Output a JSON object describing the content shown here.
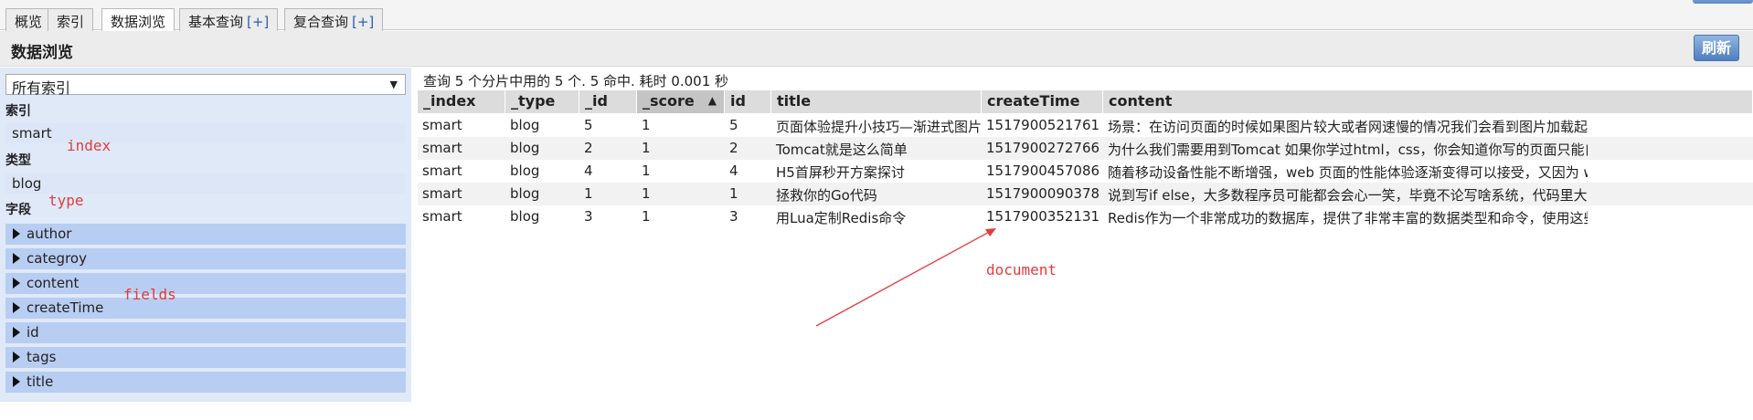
{
  "tabs": [
    {
      "label": "概览",
      "plus": ""
    },
    {
      "label": "索引",
      "plus": ""
    },
    {
      "label": "数据浏览",
      "plus": ""
    },
    {
      "label": "基本查询",
      "plus": "[+]"
    },
    {
      "label": "复合查询",
      "plus": "[+]"
    }
  ],
  "header": {
    "title": "数据浏览",
    "refresh_label": "刷新"
  },
  "sidebar": {
    "index_select": "所有索引",
    "index_label": "索引",
    "index_value": "smart",
    "type_label": "类型",
    "type_value": "blog",
    "fields_label": "字段",
    "fields": [
      "author",
      "categroy",
      "content",
      "createTime",
      "id",
      "tags",
      "title"
    ]
  },
  "annotations": {
    "index": "index",
    "type": "type",
    "fields": "fields",
    "document": "document"
  },
  "results": {
    "summary": "查询 5 个分片中用的 5 个. 5 命中. 耗时 0.001 秒",
    "columns": [
      "_index",
      "_type",
      "_id",
      "_score",
      "id",
      "title",
      "createTime",
      "content"
    ],
    "sort_arrow": "▲",
    "rows": [
      [
        "smart",
        "blog",
        "5",
        "1",
        "5",
        "页面体验提升小技巧—渐进式图片",
        "1517900521761",
        "场景：在访问页面的时候如果图片较大或者网速慢的情况我们会看到图片加载起来是有一个明显过程的，就是"
      ],
      [
        "smart",
        "blog",
        "2",
        "1",
        "2",
        "Tomcat就是这么简单",
        "1517900272766",
        "为什么我们需要用到Tomcat 如果你学过html，css，你会知道你写的页面只能自己访问，别人不能远程访问"
      ],
      [
        "smart",
        "blog",
        "4",
        "1",
        "4",
        "H5首屏秒开方案探讨",
        "1517900457086",
        "随着移动设备性能不断增强，web 页面的性能体验逐渐变得可以接受，又因为 web 开发模式的诸多好处(跨"
      ],
      [
        "smart",
        "blog",
        "1",
        "1",
        "1",
        "拯救你的Go代码",
        "1517900090378",
        "说到写if else，大多数程序员可能都会会心一笑，毕竟不论写啥系统，代码里大部分语句还是if else。业务系"
      ],
      [
        "smart",
        "blog",
        "3",
        "1",
        "3",
        "用Lua定制Redis命令",
        "1517900352131",
        "Redis作为一个非常成功的数据库，提供了非常丰富的数据类型和命令，使用这些，我们可以轻易而高效地完"
      ]
    ]
  },
  "colors": {
    "accent": "#4f7fc0",
    "annotation": "#e23c3c",
    "field_bg": "#b8cdf2",
    "sidebar_bg": "#dfe9f8"
  }
}
